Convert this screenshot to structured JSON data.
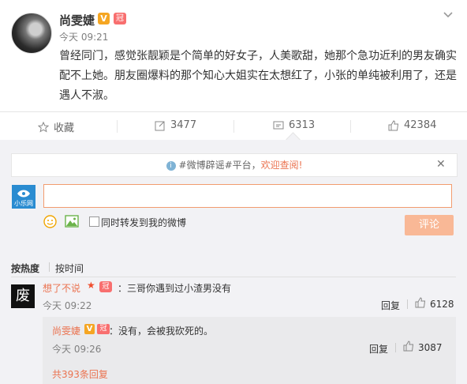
{
  "post": {
    "author": "尚雯婕",
    "verified_badge": "V",
    "member_badge": "冠",
    "time": "今天 09:21",
    "text": "曾经同门，感觉张靓颖是个简单的好女子，人美歌甜，她那个急功近利的男友确实配不上她。朋友圈爆料的那个知心大姐实在太想红了，小张的单纯被利用了，还是遇人不淑。"
  },
  "actions": {
    "favorite_label": "收藏",
    "repost_count": "3477",
    "comment_count": "6313",
    "like_count": "42384"
  },
  "notice": {
    "text_prefix": "#微博辟谣#平台，",
    "link_text": "欢迎查阅!"
  },
  "composer": {
    "avatar_text": "小乐网",
    "input_placeholder": "",
    "repost_checkbox_label": "同时转发到我的微博",
    "submit_label": "评论"
  },
  "sort": {
    "hot_label": "按热度",
    "time_label": "按时间"
  },
  "comment": {
    "avatar_char": "废",
    "author": "想了不说",
    "text": "：三哥你遇到过小渣男没有",
    "time": "今天 09:22",
    "reply_label": "回复",
    "like_count": "6128"
  },
  "reply": {
    "author": "尚雯婕",
    "verified_badge": "V",
    "member_badge": "冠",
    "text": "：没有，会被我砍死的。",
    "time": "今天 09:26",
    "reply_label": "回复",
    "like_count": "3087",
    "more_text": "共393条回复"
  },
  "colors": {
    "accent": "#eb7350",
    "panel_bg": "#f2f2f5",
    "input_border": "#f29c6f",
    "submit_bg": "#f9b896"
  }
}
